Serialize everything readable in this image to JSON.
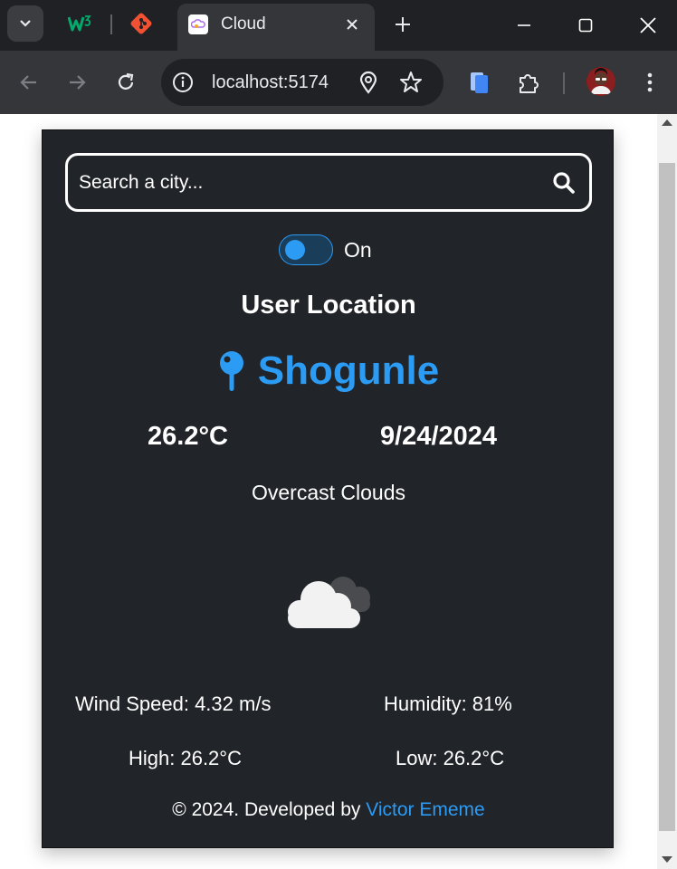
{
  "browser": {
    "active_tab": {
      "title": "Cloud"
    },
    "address_bar": {
      "url": "localhost:5174"
    }
  },
  "weather_app": {
    "search": {
      "placeholder": "Search a city..."
    },
    "location_toggle": {
      "label": "On",
      "enabled": true
    },
    "section_heading": "User Location",
    "city": "Shogunle",
    "temperature": "26.2°C",
    "date": "9/24/2024",
    "description": "Overcast Clouds",
    "icon": "overcast-clouds-icon",
    "wind_speed": "Wind Speed: 4.32 m/s",
    "humidity": "Humidity: 81%",
    "high": "High: 26.2°C",
    "low": "Low: 26.2°C",
    "footer": {
      "text": "© 2024. Developed by ",
      "author": "Victor Ememe"
    },
    "colors": {
      "accent": "#2b9bf4",
      "card_bg": "#212428",
      "text": "#ffffff"
    }
  }
}
